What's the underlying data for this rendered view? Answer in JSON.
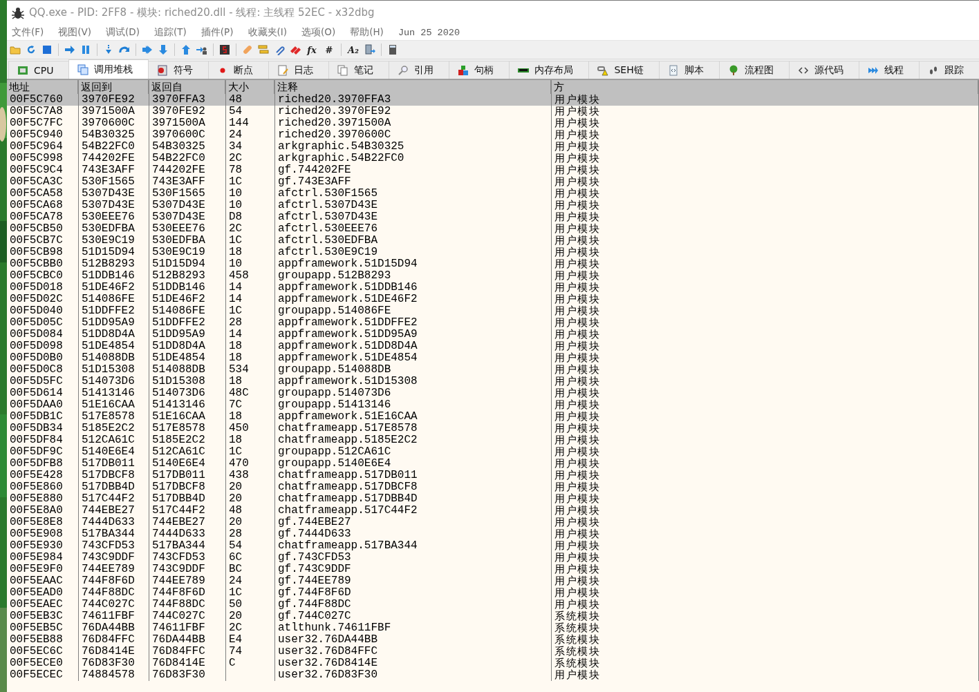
{
  "window": {
    "title": "QQ.exe - PID: 2FF8 - 模块: riched20.dll - 线程: 主线程 52EC - x32dbg"
  },
  "menu": [
    "文件(F)",
    "视图(V)",
    "调试(D)",
    "追踪(T)",
    "插件(P)",
    "收藏夹(I)",
    "选项(O)",
    "帮助(H)"
  ],
  "build_date": "Jun 25 2020",
  "toolbar_glyphs": [
    "fx",
    "#",
    "A₂"
  ],
  "tabs": [
    {
      "label": "CPU",
      "selected": false
    },
    {
      "label": "调用堆栈",
      "selected": true
    },
    {
      "label": "符号",
      "selected": false
    },
    {
      "label": "断点",
      "selected": false
    },
    {
      "label": "日志",
      "selected": false
    },
    {
      "label": "笔记",
      "selected": false
    },
    {
      "label": "引用",
      "selected": false
    },
    {
      "label": "句柄",
      "selected": false
    },
    {
      "label": "内存布局",
      "selected": false
    },
    {
      "label": "SEH链",
      "selected": false
    },
    {
      "label": "脚本",
      "selected": false
    },
    {
      "label": "流程图",
      "selected": false
    },
    {
      "label": "源代码",
      "selected": false
    },
    {
      "label": "线程",
      "selected": false
    },
    {
      "label": "跟踪",
      "selected": false
    }
  ],
  "table": {
    "columns": [
      "地址",
      "返回到",
      "返回自",
      "大小",
      "注释",
      "方"
    ],
    "rows": [
      {
        "addr": "00F5C760",
        "to": "3970FE92",
        "from": "3970FFA3",
        "size": "48",
        "comment": "riched20.3970FFA3",
        "party": "用户模块",
        "selected": true
      },
      {
        "addr": "00F5C7A8",
        "to": "3971500A",
        "from": "3970FE92",
        "size": "54",
        "comment": "riched20.3970FE92",
        "party": "用户模块",
        "selected": false
      },
      {
        "addr": "00F5C7FC",
        "to": "3970600C",
        "from": "3971500A",
        "size": "144",
        "comment": "riched20.3971500A",
        "party": "用户模块",
        "selected": false
      },
      {
        "addr": "00F5C940",
        "to": "54B30325",
        "from": "3970600C",
        "size": "24",
        "comment": "riched20.3970600C",
        "party": "用户模块",
        "selected": false
      },
      {
        "addr": "00F5C964",
        "to": "54B22FC0",
        "from": "54B30325",
        "size": "34",
        "comment": "arkgraphic.54B30325",
        "party": "用户模块",
        "selected": false
      },
      {
        "addr": "00F5C998",
        "to": "744202FE",
        "from": "54B22FC0",
        "size": "2C",
        "comment": "arkgraphic.54B22FC0",
        "party": "用户模块",
        "selected": false
      },
      {
        "addr": "00F5C9C4",
        "to": "743E3AFF",
        "from": "744202FE",
        "size": "78",
        "comment": "gf.744202FE",
        "party": "用户模块",
        "selected": false
      },
      {
        "addr": "00F5CA3C",
        "to": "530F1565",
        "from": "743E3AFF",
        "size": "1C",
        "comment": "gf.743E3AFF",
        "party": "用户模块",
        "selected": false
      },
      {
        "addr": "00F5CA58",
        "to": "5307D43E",
        "from": "530F1565",
        "size": "10",
        "comment": "afctrl.530F1565",
        "party": "用户模块",
        "selected": false
      },
      {
        "addr": "00F5CA68",
        "to": "5307D43E",
        "from": "5307D43E",
        "size": "10",
        "comment": "afctrl.5307D43E",
        "party": "用户模块",
        "selected": false
      },
      {
        "addr": "00F5CA78",
        "to": "530EEE76",
        "from": "5307D43E",
        "size": "D8",
        "comment": "afctrl.5307D43E",
        "party": "用户模块",
        "selected": false
      },
      {
        "addr": "00F5CB50",
        "to": "530EDFBA",
        "from": "530EEE76",
        "size": "2C",
        "comment": "afctrl.530EEE76",
        "party": "用户模块",
        "selected": false
      },
      {
        "addr": "00F5CB7C",
        "to": "530E9C19",
        "from": "530EDFBA",
        "size": "1C",
        "comment": "afctrl.530EDFBA",
        "party": "用户模块",
        "selected": false
      },
      {
        "addr": "00F5CB98",
        "to": "51D15D94",
        "from": "530E9C19",
        "size": "18",
        "comment": "afctrl.530E9C19",
        "party": "用户模块",
        "selected": false
      },
      {
        "addr": "00F5CBB0",
        "to": "512B8293",
        "from": "51D15D94",
        "size": "10",
        "comment": "appframework.51D15D94",
        "party": "用户模块",
        "selected": false
      },
      {
        "addr": "00F5CBC0",
        "to": "51DDB146",
        "from": "512B8293",
        "size": "458",
        "comment": "groupapp.512B8293",
        "party": "用户模块",
        "selected": false
      },
      {
        "addr": "00F5D018",
        "to": "51DE46F2",
        "from": "51DDB146",
        "size": "14",
        "comment": "appframework.51DDB146",
        "party": "用户模块",
        "selected": false
      },
      {
        "addr": "00F5D02C",
        "to": "514086FE",
        "from": "51DE46F2",
        "size": "14",
        "comment": "appframework.51DE46F2",
        "party": "用户模块",
        "selected": false
      },
      {
        "addr": "00F5D040",
        "to": "51DDFFE2",
        "from": "514086FE",
        "size": "1C",
        "comment": "groupapp.514086FE",
        "party": "用户模块",
        "selected": false
      },
      {
        "addr": "00F5D05C",
        "to": "51DD95A9",
        "from": "51DDFFE2",
        "size": "28",
        "comment": "appframework.51DDFFE2",
        "party": "用户模块",
        "selected": false
      },
      {
        "addr": "00F5D084",
        "to": "51DD8D4A",
        "from": "51DD95A9",
        "size": "14",
        "comment": "appframework.51DD95A9",
        "party": "用户模块",
        "selected": false
      },
      {
        "addr": "00F5D098",
        "to": "51DE4854",
        "from": "51DD8D4A",
        "size": "18",
        "comment": "appframework.51DD8D4A",
        "party": "用户模块",
        "selected": false
      },
      {
        "addr": "00F5D0B0",
        "to": "514088DB",
        "from": "51DE4854",
        "size": "18",
        "comment": "appframework.51DE4854",
        "party": "用户模块",
        "selected": false
      },
      {
        "addr": "00F5D0C8",
        "to": "51D15308",
        "from": "514088DB",
        "size": "534",
        "comment": "groupapp.514088DB",
        "party": "用户模块",
        "selected": false
      },
      {
        "addr": "00F5D5FC",
        "to": "514073D6",
        "from": "51D15308",
        "size": "18",
        "comment": "appframework.51D15308",
        "party": "用户模块",
        "selected": false
      },
      {
        "addr": "00F5D614",
        "to": "51413146",
        "from": "514073D6",
        "size": "48C",
        "comment": "groupapp.514073D6",
        "party": "用户模块",
        "selected": false
      },
      {
        "addr": "00F5DAA0",
        "to": "51E16CAA",
        "from": "51413146",
        "size": "7C",
        "comment": "groupapp.51413146",
        "party": "用户模块",
        "selected": false
      },
      {
        "addr": "00F5DB1C",
        "to": "517E8578",
        "from": "51E16CAA",
        "size": "18",
        "comment": "appframework.51E16CAA",
        "party": "用户模块",
        "selected": false
      },
      {
        "addr": "00F5DB34",
        "to": "5185E2C2",
        "from": "517E8578",
        "size": "450",
        "comment": "chatframeapp.517E8578",
        "party": "用户模块",
        "selected": false
      },
      {
        "addr": "00F5DF84",
        "to": "512CA61C",
        "from": "5185E2C2",
        "size": "18",
        "comment": "chatframeapp.5185E2C2",
        "party": "用户模块",
        "selected": false
      },
      {
        "addr": "00F5DF9C",
        "to": "5140E6E4",
        "from": "512CA61C",
        "size": "1C",
        "comment": "groupapp.512CA61C",
        "party": "用户模块",
        "selected": false
      },
      {
        "addr": "00F5DFB8",
        "to": "517DB011",
        "from": "5140E6E4",
        "size": "470",
        "comment": "groupapp.5140E6E4",
        "party": "用户模块",
        "selected": false
      },
      {
        "addr": "00F5E428",
        "to": "517DBCF8",
        "from": "517DB011",
        "size": "438",
        "comment": "chatframeapp.517DB011",
        "party": "用户模块",
        "selected": false
      },
      {
        "addr": "00F5E860",
        "to": "517DBB4D",
        "from": "517DBCF8",
        "size": "20",
        "comment": "chatframeapp.517DBCF8",
        "party": "用户模块",
        "selected": false
      },
      {
        "addr": "00F5E880",
        "to": "517C44F2",
        "from": "517DBB4D",
        "size": "20",
        "comment": "chatframeapp.517DBB4D",
        "party": "用户模块",
        "selected": false
      },
      {
        "addr": "00F5E8A0",
        "to": "744EBE27",
        "from": "517C44F2",
        "size": "48",
        "comment": "chatframeapp.517C44F2",
        "party": "用户模块",
        "selected": false
      },
      {
        "addr": "00F5E8E8",
        "to": "7444D633",
        "from": "744EBE27",
        "size": "20",
        "comment": "gf.744EBE27",
        "party": "用户模块",
        "selected": false
      },
      {
        "addr": "00F5E908",
        "to": "517BA344",
        "from": "7444D633",
        "size": "28",
        "comment": "gf.7444D633",
        "party": "用户模块",
        "selected": false
      },
      {
        "addr": "00F5E930",
        "to": "743CFD53",
        "from": "517BA344",
        "size": "54",
        "comment": "chatframeapp.517BA344",
        "party": "用户模块",
        "selected": false
      },
      {
        "addr": "00F5E984",
        "to": "743C9DDF",
        "from": "743CFD53",
        "size": "6C",
        "comment": "gf.743CFD53",
        "party": "用户模块",
        "selected": false
      },
      {
        "addr": "00F5E9F0",
        "to": "744EE789",
        "from": "743C9DDF",
        "size": "BC",
        "comment": "gf.743C9DDF",
        "party": "用户模块",
        "selected": false
      },
      {
        "addr": "00F5EAAC",
        "to": "744F8F6D",
        "from": "744EE789",
        "size": "24",
        "comment": "gf.744EE789",
        "party": "用户模块",
        "selected": false
      },
      {
        "addr": "00F5EAD0",
        "to": "744F88DC",
        "from": "744F8F6D",
        "size": "1C",
        "comment": "gf.744F8F6D",
        "party": "用户模块",
        "selected": false
      },
      {
        "addr": "00F5EAEC",
        "to": "744C027C",
        "from": "744F88DC",
        "size": "50",
        "comment": "gf.744F88DC",
        "party": "用户模块",
        "selected": false
      },
      {
        "addr": "00F5EB3C",
        "to": "74611FBF",
        "from": "744C027C",
        "size": "20",
        "comment": "gf.744C027C",
        "party": "系统模块",
        "selected": false
      },
      {
        "addr": "00F5EB5C",
        "to": "76DA44BB",
        "from": "74611FBF",
        "size": "2C",
        "comment": "atlthunk.74611FBF",
        "party": "系统模块",
        "selected": false
      },
      {
        "addr": "00F5EB88",
        "to": "76D84FFC",
        "from": "76DA44BB",
        "size": "E4",
        "comment": "user32.76DA44BB",
        "party": "系统模块",
        "selected": false
      },
      {
        "addr": "00F5EC6C",
        "to": "76D8414E",
        "from": "76D84FFC",
        "size": "74",
        "comment": "user32.76D84FFC",
        "party": "系统模块",
        "selected": false
      },
      {
        "addr": "00F5ECE0",
        "to": "76D83F30",
        "from": "76D8414E",
        "size": "C",
        "comment": "user32.76D8414E",
        "party": "系统模块",
        "selected": false
      },
      {
        "addr": "00F5ECEC",
        "to": "74884578",
        "from": "76D83F30",
        "comment": "user32.76D83F30",
        "party": "用户模块",
        "selected": false
      }
    ]
  }
}
